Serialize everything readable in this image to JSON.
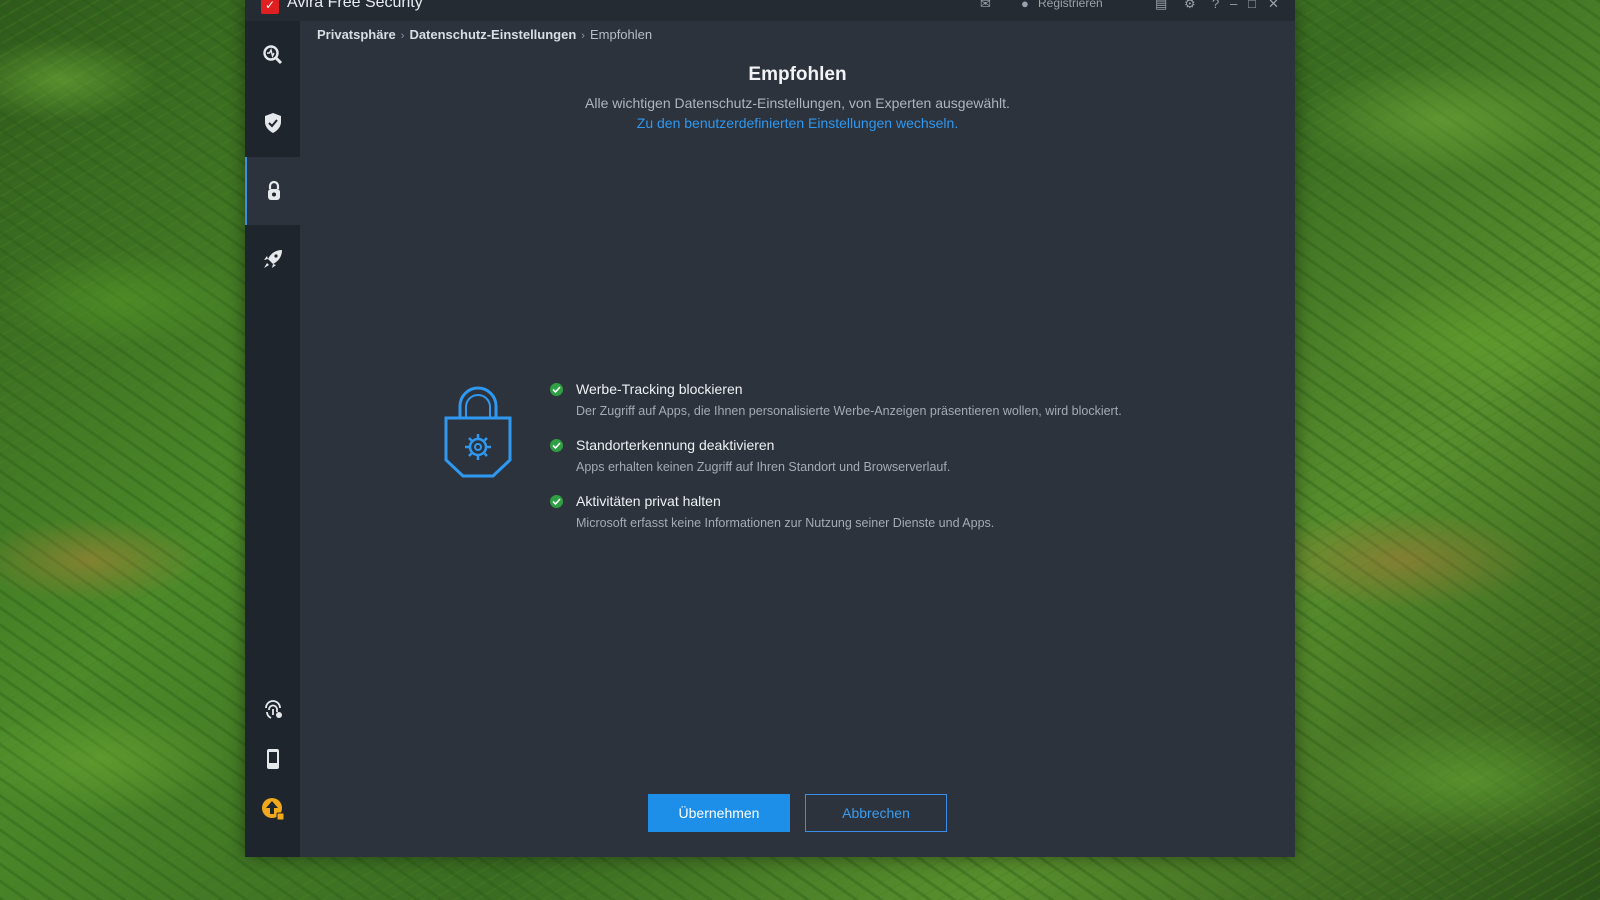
{
  "window": {
    "app_title": "Avira Free Security",
    "register_label": "Registrieren"
  },
  "titlebar_icons": [
    "mail-icon",
    "user-icon",
    "chat-icon",
    "gear-icon",
    "help-icon",
    "minimize-icon",
    "maximize-icon",
    "close-icon"
  ],
  "sidebar": {
    "items": [
      {
        "name": "status-icon"
      },
      {
        "name": "security-shield-icon"
      },
      {
        "name": "privacy-lock-icon",
        "active": true
      },
      {
        "name": "performance-rocket-icon"
      },
      {
        "name": "identity-fingerprint-icon"
      },
      {
        "name": "mobile-icon"
      },
      {
        "name": "upgrade-icon"
      }
    ]
  },
  "breadcrumb": {
    "items": [
      "Privatsphäre",
      "Datenschutz-Einstellungen",
      "Empfohlen"
    ]
  },
  "main": {
    "title": "Empfohlen",
    "subtitle": "Alle wichtigen Datenschutz-Einstellungen, von Experten ausgewählt.",
    "link": "Zu den benutzerdefinierten Einstellungen wechseln.",
    "features": [
      {
        "title": "Werbe-Tracking blockieren",
        "desc": "Der Zugriff auf Apps, die Ihnen personalisierte Werbe-Anzeigen präsentieren wollen, wird blockiert."
      },
      {
        "title": "Standorterkennung deaktivieren",
        "desc": "Apps erhalten keinen Zugriff auf Ihren Standort und Browserverlauf."
      },
      {
        "title": "Aktivitäten privat halten",
        "desc": "Microsoft erfasst keine Informationen zur Nutzung seiner Dienste und Apps."
      }
    ]
  },
  "buttons": {
    "apply": "Übernehmen",
    "cancel": "Abbrechen"
  },
  "colors": {
    "accent": "#1e8fe8",
    "check_green": "#2ea043",
    "window_bg": "#2c333d",
    "sidebar_bg": "#1f252c"
  }
}
